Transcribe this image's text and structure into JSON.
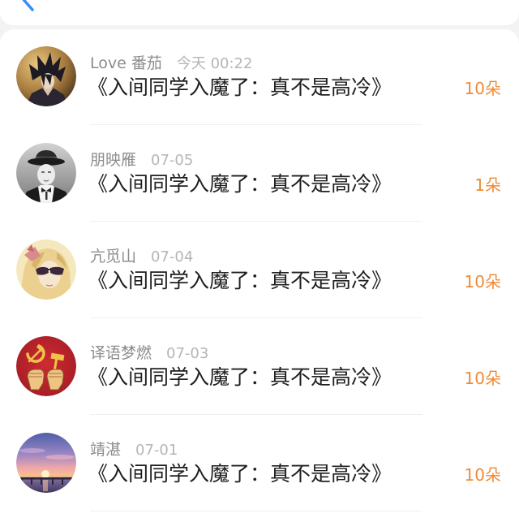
{
  "nav": {
    "back_icon": "chevron-left-icon"
  },
  "colors": {
    "count": "#f08a35",
    "back": "#3a8df3",
    "name": "#8c8c8c",
    "time": "#b5b5b5",
    "title": "#1f1f1f"
  },
  "records": [
    {
      "name": "Love 番茄",
      "time": "今天 00:22",
      "title": "《入间同学入魔了：真不是高冷》",
      "count": "10朵"
    },
    {
      "name": "朋映雁",
      "time": "07-05",
      "title": "《入间同学入魔了：真不是高冷》",
      "count": "1朵"
    },
    {
      "name": "亢觅山",
      "time": "07-04",
      "title": "《入间同学入魔了：真不是高冷》",
      "count": "10朵"
    },
    {
      "name": "译语梦燃",
      "time": "07-03",
      "title": "《入间同学入魔了：真不是高冷》",
      "count": "10朵"
    },
    {
      "name": "靖湛",
      "time": "07-01",
      "title": "《入间同学入魔了：真不是高冷》",
      "count": "10朵"
    }
  ]
}
